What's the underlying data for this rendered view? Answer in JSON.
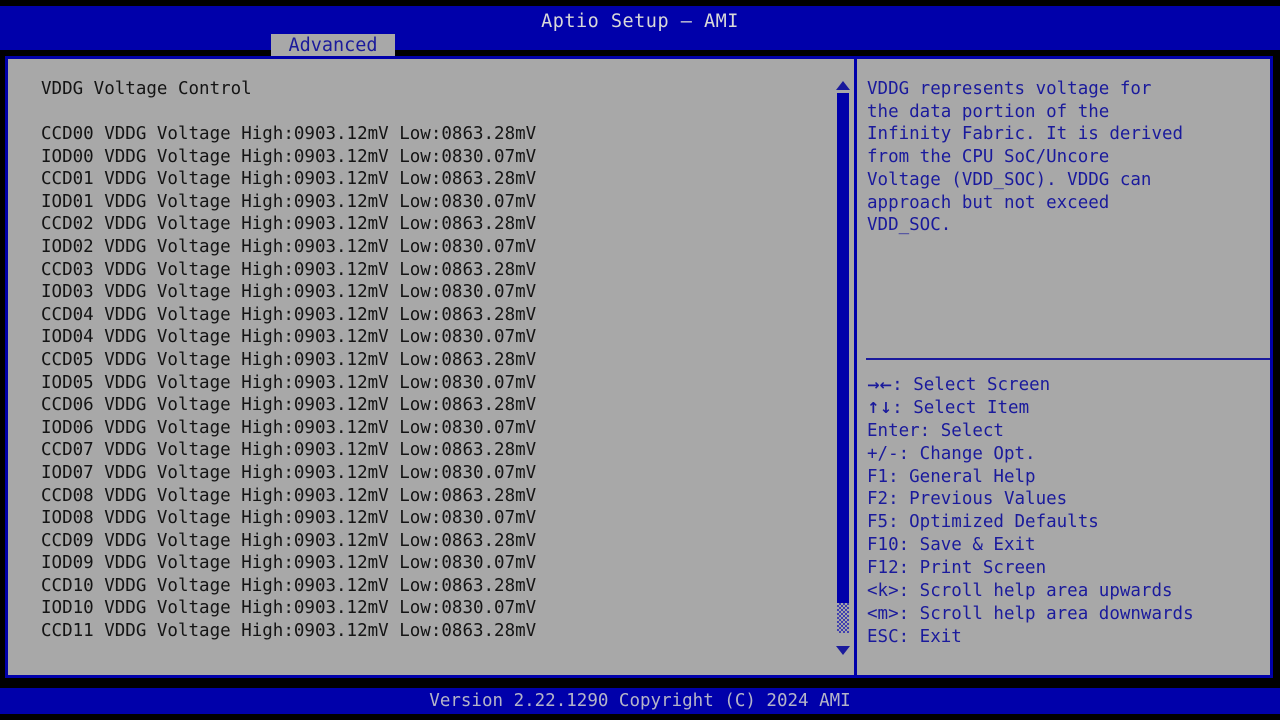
{
  "window": {
    "title": "Aptio Setup – AMI",
    "colors": {
      "header_bg": "#0000aa",
      "panel_bg": "#a8a8a8",
      "border": "#0000aa",
      "help_text": "#1a1a9c",
      "item_text": "#141414",
      "tab_bg": "#a8a8a8",
      "footer_bg": "#0000aa"
    }
  },
  "menubar": {
    "tabs": [
      {
        "label": "Advanced",
        "selected": true
      }
    ]
  },
  "main": {
    "heading": "VDDG Voltage Control",
    "rows": [
      {
        "label": "CCD00 VDDG Voltage",
        "high": "High:0903.12mV",
        "low": "Low:0863.28mV"
      },
      {
        "label": "IOD00 VDDG Voltage",
        "high": "High:0903.12mV",
        "low": "Low:0830.07mV"
      },
      {
        "label": "CCD01 VDDG Voltage",
        "high": "High:0903.12mV",
        "low": "Low:0863.28mV"
      },
      {
        "label": "IOD01 VDDG Voltage",
        "high": "High:0903.12mV",
        "low": "Low:0830.07mV"
      },
      {
        "label": "CCD02 VDDG Voltage",
        "high": "High:0903.12mV",
        "low": "Low:0863.28mV"
      },
      {
        "label": "IOD02 VDDG Voltage",
        "high": "High:0903.12mV",
        "low": "Low:0830.07mV"
      },
      {
        "label": "CCD03 VDDG Voltage",
        "high": "High:0903.12mV",
        "low": "Low:0863.28mV"
      },
      {
        "label": "IOD03 VDDG Voltage",
        "high": "High:0903.12mV",
        "low": "Low:0830.07mV"
      },
      {
        "label": "CCD04 VDDG Voltage",
        "high": "High:0903.12mV",
        "low": "Low:0863.28mV"
      },
      {
        "label": "IOD04 VDDG Voltage",
        "high": "High:0903.12mV",
        "low": "Low:0830.07mV"
      },
      {
        "label": "CCD05 VDDG Voltage",
        "high": "High:0903.12mV",
        "low": "Low:0863.28mV"
      },
      {
        "label": "IOD05 VDDG Voltage",
        "high": "High:0903.12mV",
        "low": "Low:0830.07mV"
      },
      {
        "label": "CCD06 VDDG Voltage",
        "high": "High:0903.12mV",
        "low": "Low:0863.28mV"
      },
      {
        "label": "IOD06 VDDG Voltage",
        "high": "High:0903.12mV",
        "low": "Low:0830.07mV"
      },
      {
        "label": "CCD07 VDDG Voltage",
        "high": "High:0903.12mV",
        "low": "Low:0863.28mV"
      },
      {
        "label": "IOD07 VDDG Voltage",
        "high": "High:0903.12mV",
        "low": "Low:0830.07mV"
      },
      {
        "label": "CCD08 VDDG Voltage",
        "high": "High:0903.12mV",
        "low": "Low:0863.28mV"
      },
      {
        "label": "IOD08 VDDG Voltage",
        "high": "High:0903.12mV",
        "low": "Low:0830.07mV"
      },
      {
        "label": "CCD09 VDDG Voltage",
        "high": "High:0903.12mV",
        "low": "Low:0863.28mV"
      },
      {
        "label": "IOD09 VDDG Voltage",
        "high": "High:0903.12mV",
        "low": "Low:0830.07mV"
      },
      {
        "label": "CCD10 VDDG Voltage",
        "high": "High:0903.12mV",
        "low": "Low:0863.28mV"
      },
      {
        "label": "IOD10 VDDG Voltage",
        "high": "High:0903.12mV",
        "low": "Low:0830.07mV"
      },
      {
        "label": "CCD11 VDDG Voltage",
        "high": "High:0903.12mV",
        "low": "Low:0863.28mV"
      }
    ],
    "scrollbar": {
      "up_arrow_icon": "triangle-up-icon",
      "down_arrow_icon": "triangle-down-icon",
      "thumb_position_percent": 0,
      "thumb_size_percent": 93
    }
  },
  "help": {
    "description": "VDDG represents voltage for\nthe data portion of the\nInfinity Fabric. It is derived\nfrom the CPU SoC/Uncore\nVoltage (VDD_SOC). VDDG can\napproach but not exceed\nVDD_SOC.",
    "legend": [
      {
        "keys": "→←",
        "keys_is_arrows": true,
        "text": ": Select Screen"
      },
      {
        "keys": "↑↓",
        "keys_is_arrows": true,
        "text": ": Select Item"
      },
      {
        "keys": "",
        "keys_is_arrows": false,
        "text": "Enter: Select"
      },
      {
        "keys": "",
        "keys_is_arrows": false,
        "text": "+/-: Change Opt."
      },
      {
        "keys": "",
        "keys_is_arrows": false,
        "text": "F1: General Help"
      },
      {
        "keys": "",
        "keys_is_arrows": false,
        "text": "F2: Previous Values"
      },
      {
        "keys": "",
        "keys_is_arrows": false,
        "text": "F5: Optimized Defaults"
      },
      {
        "keys": "",
        "keys_is_arrows": false,
        "text": "F10: Save & Exit"
      },
      {
        "keys": "",
        "keys_is_arrows": false,
        "text": "F12: Print Screen"
      },
      {
        "keys": "",
        "keys_is_arrows": false,
        "text": "<k>: Scroll help area upwards"
      },
      {
        "keys": "",
        "keys_is_arrows": false,
        "text": "<m>: Scroll help area downwards"
      },
      {
        "keys": "",
        "keys_is_arrows": false,
        "text": "ESC: Exit"
      }
    ]
  },
  "footer": {
    "version_text": "Version 2.22.1290 Copyright (C) 2024 AMI"
  }
}
